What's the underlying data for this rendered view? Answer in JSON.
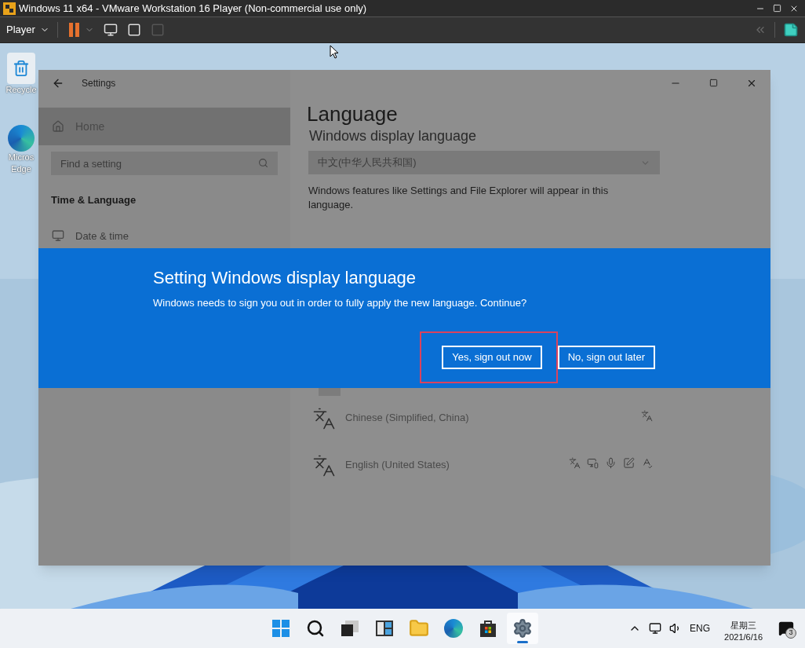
{
  "vm_window": {
    "title": "Windows 11 x64 - VMware Workstation 16 Player (Non-commercial use only)",
    "menu": "Player"
  },
  "desktop_icons": [
    {
      "kind": "recycle",
      "lines": [
        "Recycle"
      ]
    },
    {
      "kind": "edge",
      "lines": [
        "Micros",
        "Edge"
      ]
    }
  ],
  "settings": {
    "title": "Settings",
    "home": {
      "label": "Home",
      "highlighted": true
    },
    "search_placeholder": "Find a setting",
    "section": "Time & Language",
    "nav_items": [
      {
        "label": "Date & time"
      }
    ],
    "heading": "Language",
    "subheading": "Windows display language",
    "display_language": "中文(中华人民共和国)",
    "description": "Windows features like Settings and File Explorer will appear in this language.",
    "languages": [
      {
        "name": "Chinese (Simplified, China)",
        "features": [
          {
            "kind": "display"
          }
        ]
      },
      {
        "name": "English (United States)",
        "features": [
          {
            "kind": "display"
          },
          {
            "kind": "speech"
          },
          {
            "kind": "mic"
          },
          {
            "kind": "handwriting"
          },
          {
            "kind": "spelling"
          }
        ]
      }
    ]
  },
  "dialog": {
    "title": "Setting Windows display language",
    "message": "Windows needs to sign you out in order to fully apply the new language. Continue?",
    "buttons": [
      {
        "label": "Yes, sign out now",
        "highlighted": true
      },
      {
        "label": "No, sign out later",
        "highlighted": false
      }
    ]
  },
  "taskbar": {
    "apps": [
      {
        "kind": "start",
        "active": false
      },
      {
        "kind": "search",
        "active": false
      },
      {
        "kind": "taskview",
        "active": false
      },
      {
        "kind": "widgets",
        "active": false
      },
      {
        "kind": "explorer",
        "active": false
      },
      {
        "kind": "edge",
        "active": false
      },
      {
        "kind": "store",
        "active": false
      },
      {
        "kind": "settings",
        "active": true
      }
    ],
    "language": "ENG",
    "weekday": "星期三",
    "date": "2021/6/16",
    "notifications": "3"
  }
}
